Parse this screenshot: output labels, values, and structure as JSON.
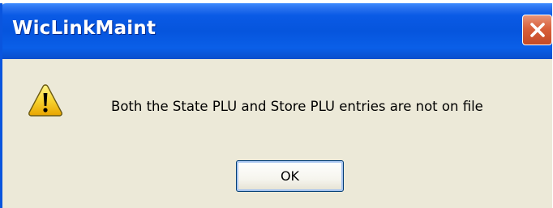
{
  "dialog": {
    "title": "WicLinkMaint",
    "message": "Both the State PLU and Store PLU entries are not on file",
    "icon": "warning-icon",
    "ok_label": "OK",
    "close_icon": "close-icon"
  },
  "colors": {
    "titlebar": "#0655dd",
    "body": "#ece9d8",
    "close": "#d8603b",
    "warning": "#f7d431"
  }
}
